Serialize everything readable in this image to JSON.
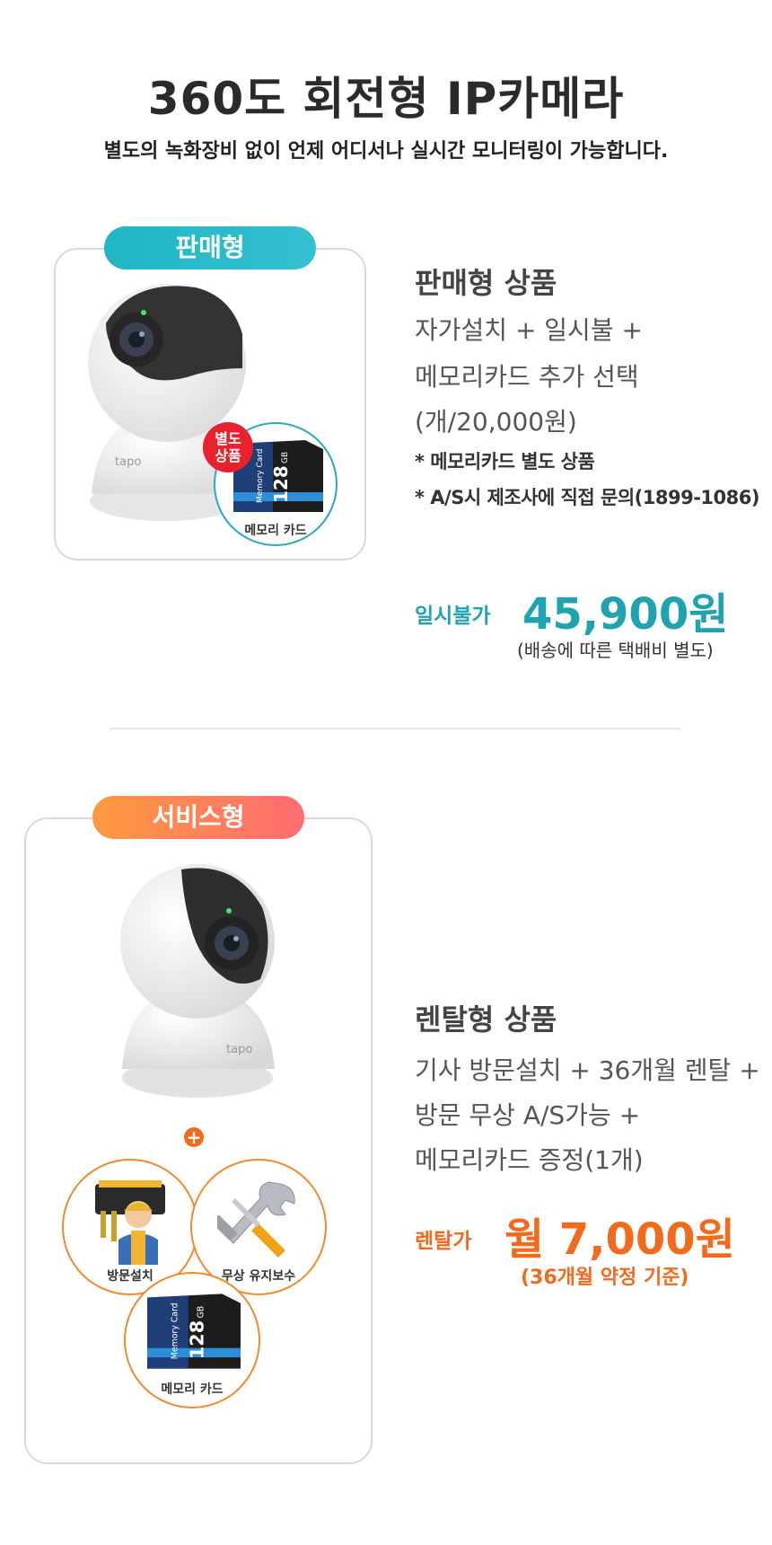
{
  "header": {
    "title": "360도 회전형 IP카메라",
    "subtitle": "별도의 녹화장비 없이 언제 어디서나 실시간 모니터링이 가능합니다."
  },
  "sale": {
    "badge": "판매형",
    "product_title": "판매형 상품",
    "lines": [
      "자가설치 + 일시불 +",
      "메모리카드 추가 선택",
      "(개/20,000원)"
    ],
    "notes": [
      "* 메모리카드 별도 상품",
      "*  A/S시 제조사에 직접 문의(1899-1086)"
    ],
    "price_label": "일시불가",
    "price": "45,900원",
    "shipping": "(배송에 따른 택배비 별도)",
    "sticker": "별도\n상품",
    "memory_caption": "메모리 카드",
    "camera_brand": "tapo",
    "card_text": "Memory Card",
    "card_size": "128",
    "card_unit": "GB"
  },
  "rental": {
    "badge": "서비스형",
    "product_title": "렌탈형 상품",
    "lines": [
      "기사 방문설치 + 36개월 렌탈 +",
      "방문 무상 A/S가능 +",
      "메모리카드 증정(1개)"
    ],
    "price_label": "렌탈가",
    "price": "월 7,000원",
    "contract": "(36개월 약정 기준)",
    "plus": "+",
    "install_caption": "방문설치",
    "maintenance_caption": "무상 유지보수",
    "memory_caption": "메모리 카드",
    "camera_brand": "tapo",
    "card_text": "Memory Card",
    "card_size": "128",
    "card_unit": "GB"
  },
  "colors": {
    "teal": "#1fa3ae",
    "orange": "#f26b1d",
    "sale_badge": "#22b8c5",
    "rental_badge": "#ff7e58"
  }
}
